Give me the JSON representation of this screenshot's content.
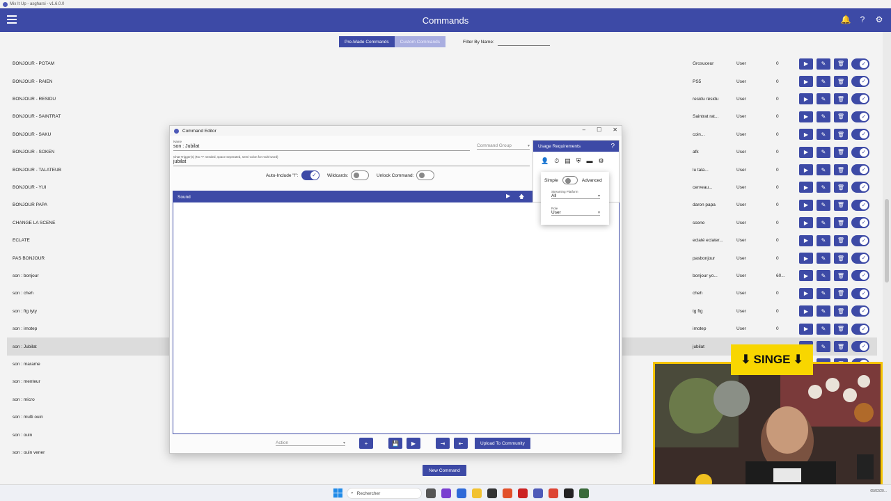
{
  "os_title": "Mix It Up - asgharsi - v1.6.0.0",
  "header": {
    "title": "Commands"
  },
  "tabs": {
    "premade": "Pre-Made Commands",
    "custom": "Custom Commands"
  },
  "filter": {
    "label": "Filter By Name:"
  },
  "commands": [
    {
      "name": "BONJOUR - POTAM",
      "trigger": "Grosuceur",
      "role": "User",
      "cost": "0"
    },
    {
      "name": "BONJOUR - RAIEN",
      "trigger": "PS5",
      "role": "User",
      "cost": "0"
    },
    {
      "name": "BONJOUR - RESIDU",
      "trigger": "residu résidu",
      "role": "User",
      "cost": "0"
    },
    {
      "name": "BONJOUR - SAINTRAT",
      "trigger": "Saintrat rat...",
      "role": "User",
      "cost": "0"
    },
    {
      "name": "BONJOUR - SAKU",
      "trigger": "coin...",
      "role": "User",
      "cost": "0"
    },
    {
      "name": "BONJOUR - SOKEN",
      "trigger": "afk",
      "role": "User",
      "cost": "0"
    },
    {
      "name": "BONJOUR - TALATEUB",
      "trigger": "lu tala...",
      "role": "User",
      "cost": "0"
    },
    {
      "name": "BONJOUR - YUI",
      "trigger": "cerveau...",
      "role": "User",
      "cost": "0"
    },
    {
      "name": "BONJOUR PAPA",
      "trigger": "daron papa",
      "role": "User",
      "cost": "0"
    },
    {
      "name": "CHANGE LA SCENE",
      "trigger": "scene",
      "role": "User",
      "cost": "0"
    },
    {
      "name": "ECLATE",
      "trigger": "eclaté eclater...",
      "role": "User",
      "cost": "0"
    },
    {
      "name": "PAS BONJOUR",
      "trigger": "pasbonjour",
      "role": "User",
      "cost": "0"
    },
    {
      "name": "son : bonjour",
      "trigger": "bonjour yo...",
      "role": "User",
      "cost": "60..."
    },
    {
      "name": "son : cheh",
      "trigger": "cheh",
      "role": "User",
      "cost": "0"
    },
    {
      "name": "son : ftg tyty",
      "trigger": "tg ftg",
      "role": "User",
      "cost": "0"
    },
    {
      "name": "son : imotep",
      "trigger": "imotep",
      "role": "User",
      "cost": "0"
    },
    {
      "name": "son : Jubilat",
      "trigger": "jubilat",
      "role": "",
      "cost": ""
    },
    {
      "name": "son : marame",
      "trigger": "",
      "role": "",
      "cost": ""
    },
    {
      "name": "son : menteur",
      "trigger": "",
      "role": "",
      "cost": ""
    },
    {
      "name": "son : micro",
      "trigger": "",
      "role": "",
      "cost": ""
    },
    {
      "name": "son : multi ouin",
      "trigger": "",
      "role": "",
      "cost": ""
    },
    {
      "name": "son : ouin",
      "trigger": "",
      "role": "",
      "cost": ""
    },
    {
      "name": "son : ouin vener",
      "trigger": "",
      "role": "",
      "cost": ""
    }
  ],
  "selected_row": 16,
  "new_command_label": "New Command",
  "editor": {
    "title": "Command Editor",
    "name_label": "Name",
    "name_value": "son : Jubilat",
    "group_placeholder": "Command Group",
    "triggers_label": "Chat Trigger(s) (No \"!\" needed, space seperated, semi-colon for multi-word)",
    "triggers_value": "jubilat",
    "auto_include_label": "Auto-Include \"!\":",
    "wildcards_label": "Wildcards:",
    "unlock_label": "Unlock Command:",
    "sound_label": "Sound",
    "action_placeholder": "Action",
    "upload_label": "Upload To Community"
  },
  "usage": {
    "title": "Usage Requirements",
    "help": "?",
    "simple_label": "Simple",
    "advanced_label": "Advanced",
    "platform_label": "Streaming Platform",
    "platform_value": "All",
    "role_label": "Role",
    "role_value": "User"
  },
  "overlay": {
    "banner": "SINGE"
  },
  "taskbar": {
    "search_placeholder": "Rechercher",
    "date": "05/02/20..."
  },
  "colors": {
    "accent": "#3d4aa6",
    "banner": "#f8d600"
  }
}
